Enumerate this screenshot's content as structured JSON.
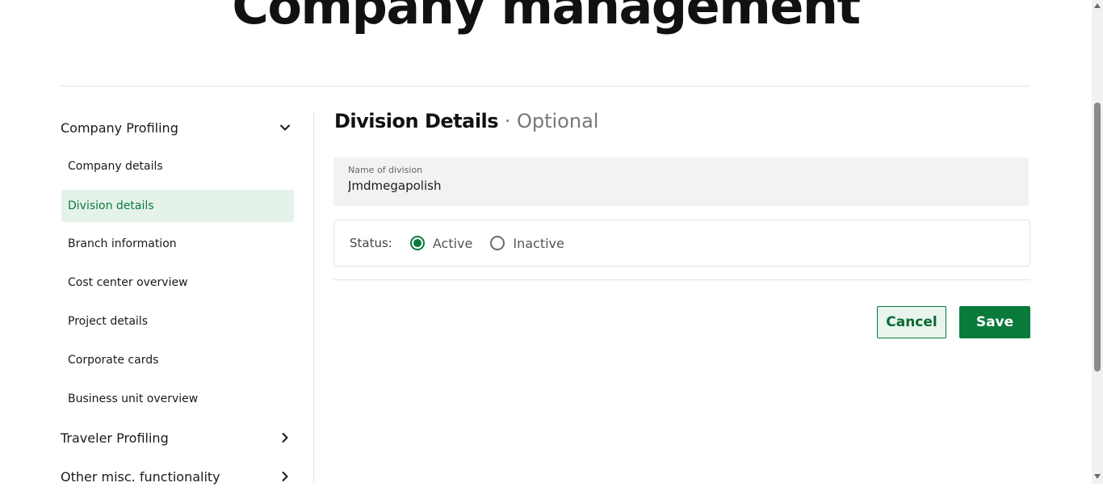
{
  "page": {
    "title": "Company management"
  },
  "sidebar": {
    "sections": [
      {
        "label": "Company Profiling",
        "expanded": true,
        "icon": "chevron-down-icon",
        "items": [
          {
            "label": "Company details",
            "active": false
          },
          {
            "label": "Division details",
            "active": true
          },
          {
            "label": "Branch information",
            "active": false
          },
          {
            "label": "Cost center overview",
            "active": false
          },
          {
            "label": "Project details",
            "active": false
          },
          {
            "label": "Corporate cards",
            "active": false
          },
          {
            "label": "Business unit overview",
            "active": false
          }
        ]
      },
      {
        "label": "Traveler Profiling",
        "expanded": false,
        "icon": "chevron-right-icon"
      },
      {
        "label": "Other misc. functionality",
        "expanded": false,
        "icon": "chevron-right-icon"
      }
    ]
  },
  "main": {
    "heading": "Division Details",
    "heading_suffix": "· Optional",
    "name_field": {
      "label": "Name of division",
      "value": "Jmdmegapolish"
    },
    "status": {
      "label": "Status:",
      "options": [
        {
          "label": "Active",
          "checked": true
        },
        {
          "label": "Inactive",
          "checked": false
        }
      ]
    },
    "actions": {
      "cancel_label": "Cancel",
      "save_label": "Save"
    }
  },
  "colors": {
    "accent": "#0a7a3b",
    "active_bg": "#e5f2e9",
    "field_bg": "#f2f2f2",
    "divider": "#e2e2e2"
  }
}
